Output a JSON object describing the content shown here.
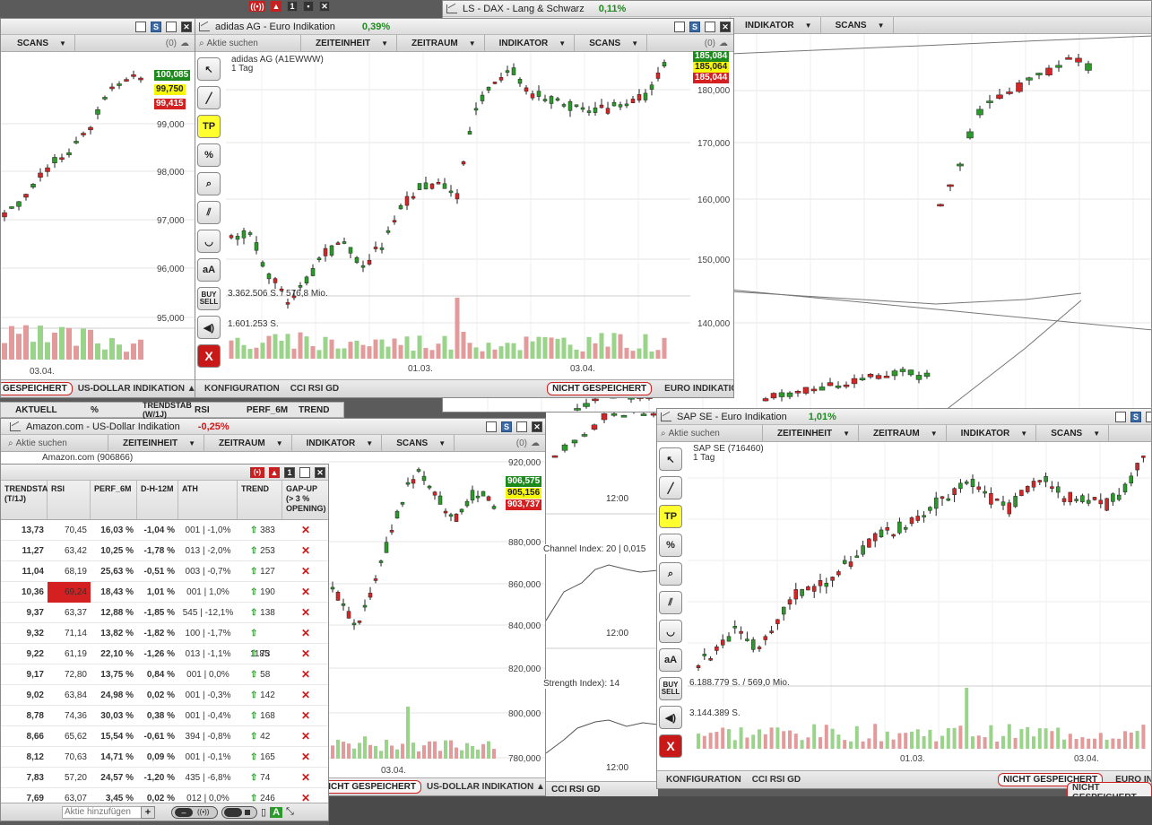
{
  "topbar": {
    "icons": [
      "wifi-icon",
      "alarm-icon",
      "one-icon",
      "layout-icon",
      "close-icon"
    ]
  },
  "dax": {
    "title": "LS - DAX - Lang & Schwarz",
    "change": "0,11%",
    "menu": [
      "INDIKATOR",
      "SCANS"
    ],
    "y_labels": [
      "180,000",
      "170,000",
      "160,000",
      "150,000",
      "140,000"
    ],
    "tags": [
      "185,084",
      "185,064",
      "185,044"
    ]
  },
  "left": {
    "menu": "SCANS",
    "counter": "(0)",
    "y_labels": [
      "99,000",
      "98,000",
      "97,000",
      "96,000",
      "95,000"
    ],
    "tags": [
      "100,085",
      "99,750",
      "99,415"
    ],
    "date": "03.04.",
    "status": [
      "GESPEICHERT",
      "US-DOLLAR INDIKATION ▲"
    ]
  },
  "adidas": {
    "title": "adidas AG - Euro Indikation",
    "change": "0,39%",
    "search": "Aktie suchen",
    "menu": [
      "ZEITEINHEIT",
      "ZEITRAUM",
      "INDIKATOR",
      "SCANS"
    ],
    "counter": "(0)",
    "name": "adidas AG (A1EWWW)",
    "period": "1 Tag",
    "vol1": "3.362.506 S. / 576,8 Mio.",
    "vol2": "1.601.253 S.",
    "y_labels": [
      "180,000",
      "170,000",
      "160,000",
      "150,000",
      "140,000"
    ],
    "tags": [
      "185,084",
      "185,064",
      "185,044"
    ],
    "dates": [
      "01.03.",
      "03.04."
    ],
    "status": [
      "KONFIGURATION",
      "CCI RSI GD",
      "NICHT GESPEICHERT",
      "EURO INDIKATION ▲"
    ]
  },
  "amazon": {
    "title": "Amazon.com - US-Dollar Indikation",
    "change": "-0,25%",
    "search": "Aktie suchen",
    "menu": [
      "ZEITEINHEIT",
      "ZEITRAUM",
      "INDIKATOR",
      "SCANS"
    ],
    "counter": "(0)",
    "name": "Amazon.com (906866)",
    "y_labels": [
      "920,000",
      "880,000",
      "860,000",
      "840,000",
      "820,000",
      "800,000",
      "780,000"
    ],
    "tags": [
      "906,575",
      "905,156",
      "903,737"
    ],
    "date": "03.04.",
    "status": [
      "NICHT GESPEICHERT",
      "US-DOLLAR INDIKATION ▲"
    ],
    "times": [
      "12:00",
      "12:00",
      "12:00"
    ],
    "ind1": "Channel Index: 20 | 0,015",
    "ind2": "Strength Index): 14"
  },
  "under": {
    "headers": [
      "AKTUELL",
      "%",
      "TRENDSTAB (W/1J)",
      "RSI",
      "PERF_6M",
      "TREND"
    ]
  },
  "scan": {
    "headers": [
      "TRENDSTA (T/1J)",
      "RSI",
      "PERF_6M",
      "D-H-12M",
      "ATH",
      "TREND",
      "GAP-UP (> 3 % OPENING)"
    ],
    "rows": [
      [
        "13,73",
        "70,45",
        "16,03 %",
        "-1,04 %",
        "001 | -1,0%",
        "383"
      ],
      [
        "11,27",
        "63,42",
        "10,25 %",
        "-1,78 %",
        "013 | -2,0%",
        "253"
      ],
      [
        "11,04",
        "68,19",
        "25,63 %",
        "-0,51 %",
        "003 | -0,7%",
        "127"
      ],
      [
        "10,36",
        "69,24",
        "18,43 %",
        "1,01 %",
        "001 | 1,0%",
        "190"
      ],
      [
        "9,37",
        "63,37",
        "12,88 %",
        "-1,85 %",
        "545 | -12,1%",
        "138"
      ],
      [
        "9,32",
        "71,14",
        "13,82 %",
        "-1,82 %",
        "100 | -1,7%",
        "1185"
      ],
      [
        "9,22",
        "61,19",
        "22,10 %",
        "-1,26 %",
        "013 | -1,1%",
        "73"
      ],
      [
        "9,17",
        "72,80",
        "13,75 %",
        "0,84 %",
        "001 | 0,0%",
        "58"
      ],
      [
        "9,02",
        "63,84",
        "24,98 %",
        "0,02 %",
        "001 | -0,3%",
        "142"
      ],
      [
        "8,78",
        "74,36",
        "30,03 %",
        "0,38 %",
        "001 | -0,4%",
        "168"
      ],
      [
        "8,66",
        "65,62",
        "15,54 %",
        "-0,61 %",
        "394 | -0,8%",
        "42"
      ],
      [
        "8,12",
        "70,63",
        "14,71 %",
        "0,09 %",
        "001 | -0,1%",
        "165"
      ],
      [
        "7,83",
        "57,20",
        "24,57 %",
        "-1,20 %",
        "435 | -6,8%",
        "74"
      ],
      [
        "7,69",
        "63,07",
        "3,45 %",
        "0,02 %",
        "012 | 0,0%",
        "246"
      ]
    ],
    "add_placeholder": "Aktie hinzufügen",
    "add": "+"
  },
  "sap": {
    "title": "SAP SE - Euro Indikation",
    "change": "1,01%",
    "search": "Aktie suchen",
    "menu": [
      "ZEITEINHEIT",
      "ZEITRAUM",
      "INDIKATOR",
      "SCANS"
    ],
    "name": "SAP SE (716460)",
    "period": "1 Tag",
    "vol1": "6.188.779 S. / 569,0 Mio.",
    "vol2": "3.144.389 S.",
    "dates": [
      "01.03.",
      "03.04."
    ],
    "status": [
      "KONFIGURATION",
      "CCI RSI GD",
      "NICHT GESPEICHERT",
      "EURO INDIKATI"
    ],
    "bottom_clip": "NICHT GESPEICHERT"
  },
  "tools": [
    "pointer-tool",
    "line-tool",
    "TP",
    "%",
    "zoom-tool",
    "parallel-tool",
    "curve-tool",
    "aA",
    "BUY SELL",
    "sound-tool",
    "X"
  ],
  "colors": {
    "up": "#2b9a2b",
    "down": "#d42626",
    "volup": "#9ad38a",
    "voldown": "#e39a9a"
  }
}
